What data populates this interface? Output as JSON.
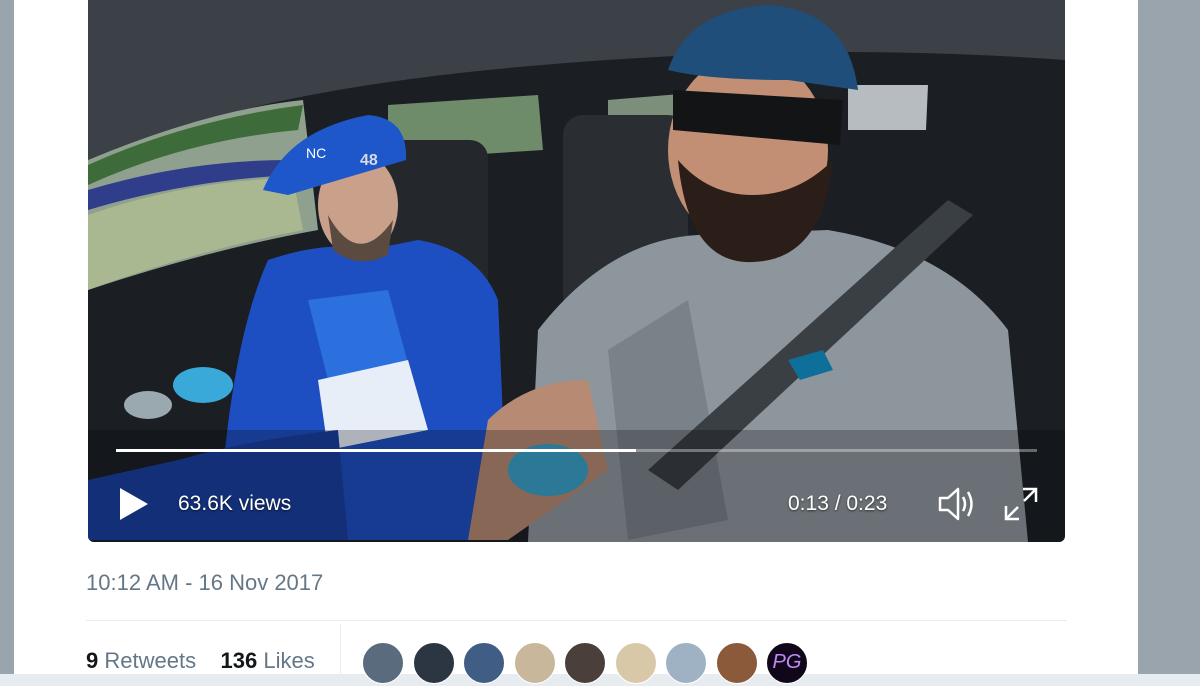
{
  "video": {
    "views": "63.6K views",
    "time": "0:13 / 0:23",
    "progress": 0.565,
    "cap_lettering": "NC",
    "cap_number": "48"
  },
  "tweet": {
    "timestamp": "10:12 AM - 16 Nov 2017",
    "retweets_count": "9",
    "retweets_label": "Retweets",
    "likes_count": "136",
    "likes_label": "Likes"
  },
  "avatars": [
    {
      "name": "avatar-1",
      "color": "#5a6b7d"
    },
    {
      "name": "avatar-2",
      "color": "#2b3642"
    },
    {
      "name": "avatar-3",
      "color": "#3f5d85"
    },
    {
      "name": "avatar-4",
      "color": "#c9b79c"
    },
    {
      "name": "avatar-5",
      "color": "#4a3f3a"
    },
    {
      "name": "avatar-6",
      "color": "#d8c8a8"
    },
    {
      "name": "avatar-7",
      "color": "#9fb2c4"
    },
    {
      "name": "avatar-8",
      "color": "#8a5a3a"
    },
    {
      "name": "avatar-9",
      "color": "#10081a",
      "text": "PG"
    }
  ],
  "colors": {
    "muted_text": "#657786",
    "strong_text": "#14171a",
    "page_bg": "#e6ecf0"
  },
  "icons": {
    "play": "play-icon",
    "volume": "volume-icon",
    "fullscreen": "fullscreen-icon"
  }
}
